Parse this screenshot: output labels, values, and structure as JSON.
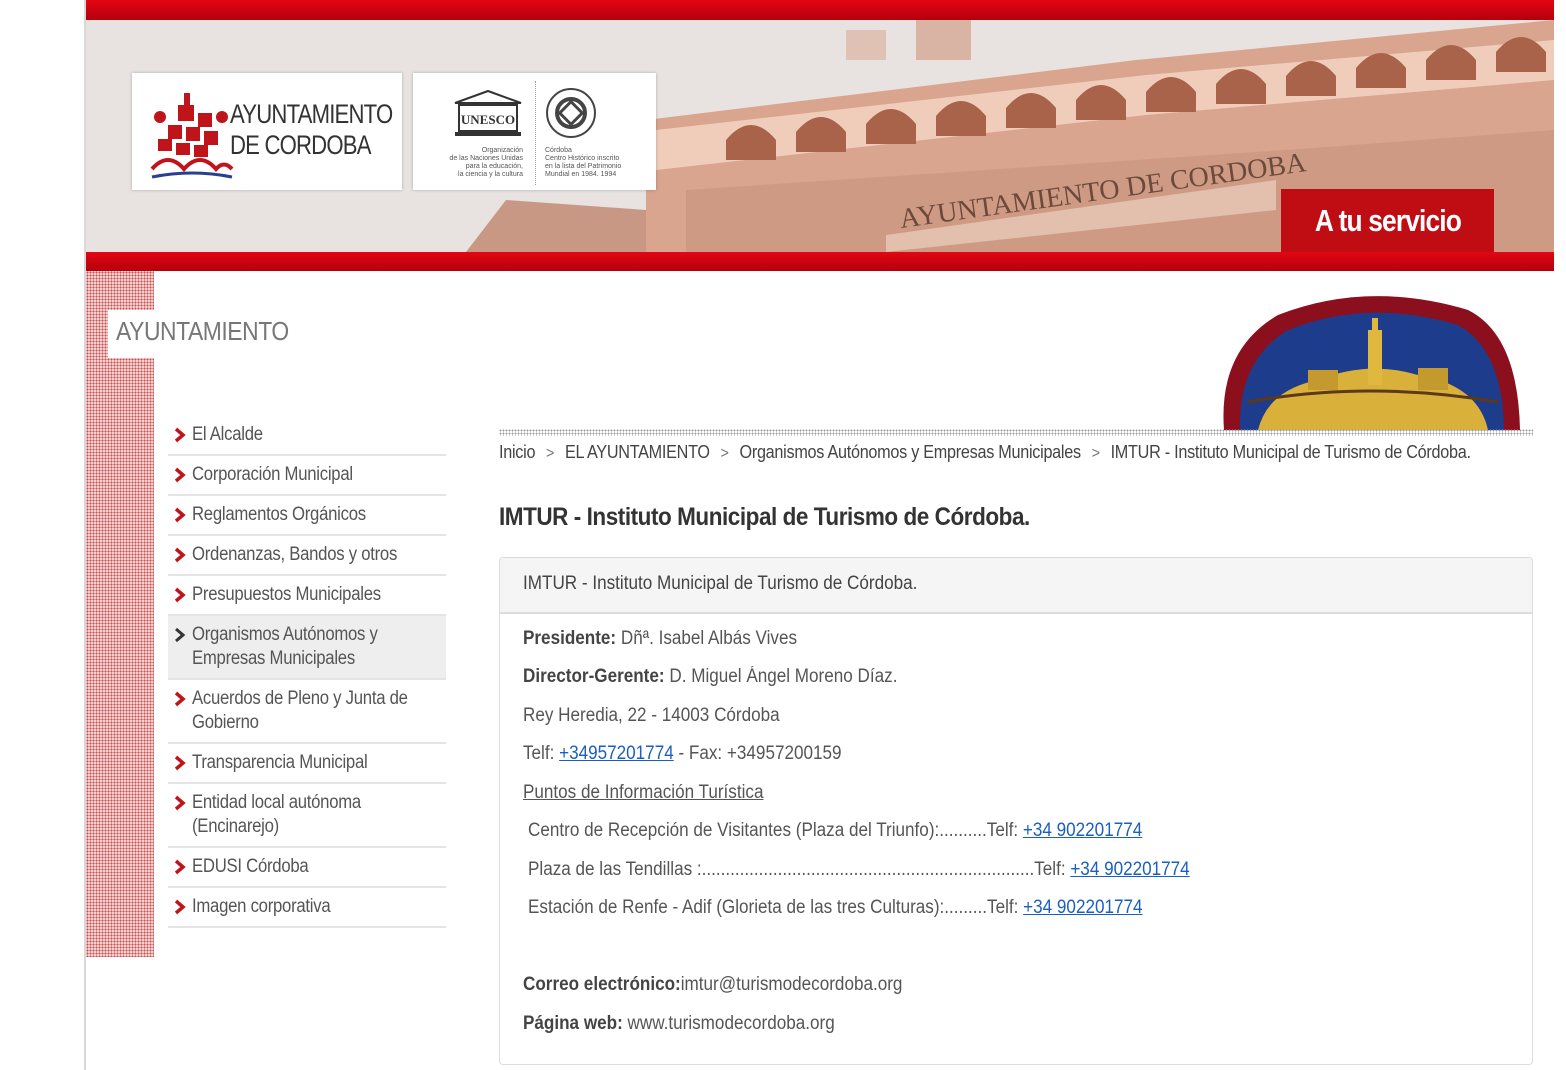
{
  "header": {
    "logo_ayto_line1": "AYUNTAMIENTO",
    "logo_ayto_line2": "DE CORDOBA",
    "unesco_name": "UNESCO",
    "unesco_caption_left": [
      "Organización",
      "de las Naciones Unidas",
      "para la educación,",
      "la ciencia y la cultura"
    ],
    "unesco_caption_right": [
      "Córdoba",
      "Centro Histórico inscrito",
      "en la lista del Patrimonio",
      "Mundial en 1984. 1994"
    ],
    "building_sign": "AYUNTAMIENTO DE CORDOBA",
    "servicio_label": "A tu servicio"
  },
  "sidebar": {
    "section_title": "AYUNTAMIENTO",
    "items": [
      {
        "label": "El Alcalde"
      },
      {
        "label": "Corporación Municipal"
      },
      {
        "label": "Reglamentos Orgánicos"
      },
      {
        "label": "Ordenanzas, Bandos y otros"
      },
      {
        "label": "Presupuestos Municipales"
      },
      {
        "label": "Organismos Autónomos y Empresas Municipales",
        "active": true
      },
      {
        "label": "Acuerdos de Pleno y Junta de Gobierno"
      },
      {
        "label": "Transparencia Municipal"
      },
      {
        "label": "Entidad local autónoma (Encinarejo)"
      },
      {
        "label": "EDUSI Córdoba"
      },
      {
        "label": "Imagen corporativa"
      }
    ]
  },
  "breadcrumb": {
    "items": [
      "Inicio",
      "EL AYUNTAMIENTO",
      "Organismos Autónomos y Empresas Municipales",
      "IMTUR - Instituto Municipal de Turismo de Córdoba."
    ],
    "separator": ">"
  },
  "page": {
    "title": "IMTUR - Instituto Municipal de Turismo de Córdoba.",
    "panel_title": "IMTUR - Instituto Municipal de Turismo de Córdoba.",
    "presidente_label": "Presidente:",
    "presidente_value": " Dñª. Isabel Albás Vives",
    "director_label": "Director-Gerente:",
    "director_value": " D. Miguel Ángel Moreno Díaz.",
    "address": "Rey Heredia, 22 - 14003 Córdoba",
    "telf_prefix": "Telf: ",
    "telf_link": "+34957201774",
    "fax_text": " - Fax: +34957200159",
    "puntos_heading": "Puntos de Información Turística",
    "puntos": [
      {
        "text": "Centro de Recepción de Visitantes (Plaza del Triunfo):..........Telf: ",
        "phone": "+34 902201774"
      },
      {
        "text": "Plaza de las Tendillas :......................................................................Telf: ",
        "phone": "+34 902201774"
      },
      {
        "text": "Estación de Renfe - Adif (Glorieta de las tres Culturas):.........Telf: ",
        "phone": "+34 902201774"
      }
    ],
    "email_label": "Correo electrónico:",
    "email_value": "imtur@turismodecordoba.org",
    "web_label": "Página web:",
    "web_value": " www.turismodecordoba.org"
  },
  "colors": {
    "brand_red": "#c00d14",
    "link_blue": "#1a5fbf",
    "text": "#444444"
  },
  "icons": [
    "chevron-right-icon"
  ]
}
